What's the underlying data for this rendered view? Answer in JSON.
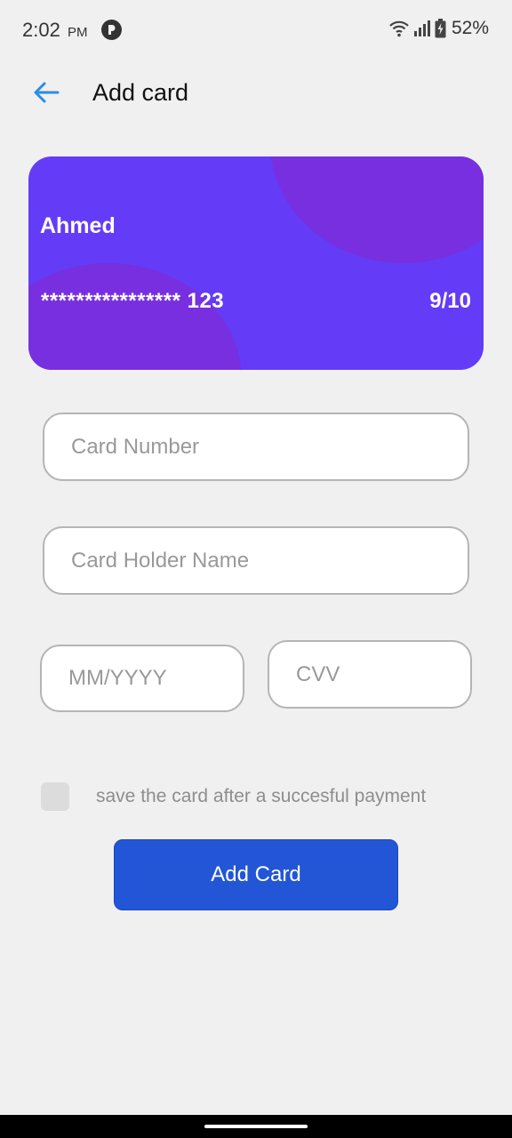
{
  "status_bar": {
    "time": "2:02",
    "ampm": "PM",
    "battery": "52%",
    "icons": [
      "app-notification-icon",
      "wifi-icon",
      "signal-icon",
      "battery-icon"
    ]
  },
  "header": {
    "title": "Add card",
    "back_icon": "arrow-left-icon"
  },
  "card_preview": {
    "holder": "Ahmed",
    "number_masked": "**************** 123",
    "expiry": "9/10",
    "colors": {
      "base": "#643cf7",
      "accent": "#772fe0"
    }
  },
  "form": {
    "card_number": {
      "value": "",
      "placeholder": "Card Number"
    },
    "holder_name": {
      "value": "",
      "placeholder": "Card Holder Name"
    },
    "expiry": {
      "value": "",
      "placeholder": "MM/YYYY"
    },
    "cvv": {
      "value": "",
      "placeholder": "CVV"
    },
    "save_card": {
      "checked": false,
      "label": "save the card after a succesful payment"
    },
    "submit_label": "Add Card"
  },
  "colors": {
    "background": "#f0f0f0",
    "primary_button": "#2356d6",
    "back_arrow": "#2a8ce8"
  }
}
